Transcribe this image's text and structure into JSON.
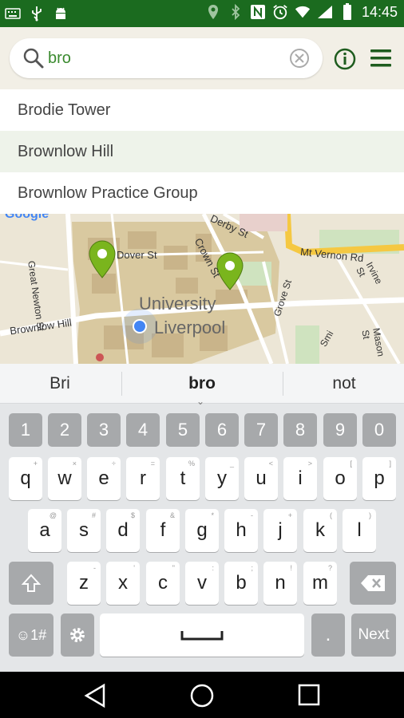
{
  "status_bar": {
    "time": "14:45",
    "left_icons": [
      "keyboard-icon",
      "usb-icon",
      "android-icon"
    ],
    "right_icons": [
      "location-icon",
      "bluetooth-icon",
      "nfc-icon",
      "alarm-icon",
      "wifi-icon",
      "signal-icon",
      "battery-icon"
    ]
  },
  "search": {
    "query": "bro",
    "icons": {
      "search": "search-icon",
      "clear": "clear-circle-icon"
    }
  },
  "header_actions": {
    "info": "info-icon",
    "menu": "hamburger-menu-icon"
  },
  "suggestions": [
    {
      "label": "Brodie Tower"
    },
    {
      "label": "Brownlow Hill"
    },
    {
      "label": "Brownlow Practice Group"
    }
  ],
  "map": {
    "google_label": "Google",
    "labels": {
      "dover": "Dover St",
      "great_newton": "Great Newton St",
      "derby": "Derby St",
      "crown": "Crown St",
      "vernon": "Mt Vernon Rd",
      "irvine": "Irvine St",
      "university": "University",
      "liverpool": "Liverpool",
      "brownlow": "Brownlow Hill",
      "grove": "Grove St",
      "mason": "Mason St",
      "smith": "Smi"
    },
    "colors": {
      "pin": "#7ab51d",
      "location": "#4285f4",
      "campus": "#d8c79e",
      "road": "#ffffff",
      "major_road": "#f5c842"
    }
  },
  "keyboard": {
    "predictions": [
      "Bri",
      "bro",
      "not"
    ],
    "number_row": [
      "1",
      "2",
      "3",
      "4",
      "5",
      "6",
      "7",
      "8",
      "9",
      "0"
    ],
    "row1": [
      "q",
      "w",
      "e",
      "r",
      "t",
      "y",
      "u",
      "i",
      "o",
      "p"
    ],
    "row1_hints": [
      "+",
      "×",
      "÷",
      "=",
      "%",
      "_",
      "<",
      ">",
      "[",
      "]"
    ],
    "row2": [
      "a",
      "s",
      "d",
      "f",
      "g",
      "h",
      "j",
      "k",
      "l"
    ],
    "row2_hints": [
      "@",
      "#",
      "$",
      "&",
      "*",
      "-",
      "+",
      "(",
      ")"
    ],
    "row3": [
      "z",
      "x",
      "c",
      "v",
      "b",
      "n",
      "m"
    ],
    "row3_hints": [
      "-",
      "'",
      "\"",
      ":",
      ";",
      "!",
      "?"
    ],
    "symbols_label": "☺1#",
    "period_label": ".",
    "next_label": "Next"
  }
}
